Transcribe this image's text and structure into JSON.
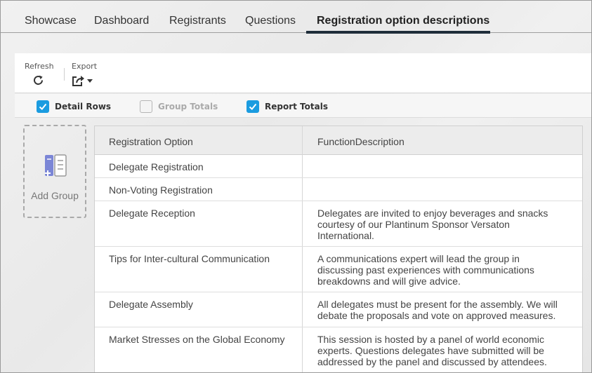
{
  "tabs": [
    {
      "label": "Showcase"
    },
    {
      "label": "Dashboard"
    },
    {
      "label": "Registrants"
    },
    {
      "label": "Questions"
    },
    {
      "label": "Registration option descriptions",
      "active": true
    }
  ],
  "toolbar": {
    "refresh_label": "Refresh",
    "refresh_icon": "refresh-icon",
    "export_label": "Export",
    "export_icon": "export-share-icon"
  },
  "checks": [
    {
      "label": "Detail Rows",
      "checked": true,
      "disabled": false
    },
    {
      "label": "Group Totals",
      "checked": false,
      "disabled": true
    },
    {
      "label": "Report Totals",
      "checked": true,
      "disabled": false
    }
  ],
  "add_group": {
    "label": "Add Group",
    "icon": "add-group-icon"
  },
  "grid": {
    "columns": [
      "Registration Option",
      "FunctionDescription"
    ],
    "rows": [
      {
        "option": "Delegate Registration",
        "description": ""
      },
      {
        "option": "Non-Voting Registration",
        "description": ""
      },
      {
        "option": "Delegate Reception",
        "description": "Delegates are invited to enjoy beverages and snacks courtesy of our Plantinum Sponsor Versaton International."
      },
      {
        "option": "Tips for Inter-cultural Communication",
        "description": "A communications expert will lead the group in discussing past experiences with communications breakdowns and will give advice."
      },
      {
        "option": "Delegate Assembly",
        "description": "All delegates must be present for the assembly. We will debate the proposals and vote on approved measures."
      },
      {
        "option": "Market Stresses on the Global Economy",
        "description": "This session is hosted by a panel of world economic experts. Questions delegates have submitted will be addressed by the panel and discussed by attendees."
      }
    ]
  },
  "colors": {
    "accent": "#1b9ce0",
    "tab_underline": "#1f2d3a"
  }
}
